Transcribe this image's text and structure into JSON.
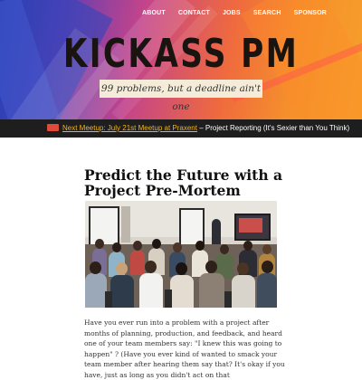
{
  "nav": {
    "items": [
      {
        "label": "ABOUT"
      },
      {
        "label": "CONTACT"
      },
      {
        "label": "JOBS"
      },
      {
        "label": "SEARCH"
      },
      {
        "label": "SPONSOR"
      }
    ]
  },
  "header": {
    "site_title": "KICKASS PM",
    "tagline": "99 problems, but a deadline ain't one"
  },
  "meetup": {
    "icon": "meetup-logo-icon",
    "link_text": "Next Meetup: July 21st Meetup at Praxent",
    "rest_text": " – Project Reporting (It's Sexier than You Think)"
  },
  "article": {
    "title": "Predict the Future with a Project Pre-Mortem",
    "intro": "Have you ever run into a problem with a project after months of planning, production, and feedback, and heard one of your team members say: \"I knew this was going to happen\" ? (Have you ever kind of wanted to smack your team member after hearing them say that? It's okay if you have, just as long as you didn't act on that"
  },
  "colors": {
    "meetup_bar": "#1e1e1e",
    "meetup_link": "#f5b11c",
    "tagline_bg": "#f4ecd8",
    "title_text": "#1a1410"
  }
}
